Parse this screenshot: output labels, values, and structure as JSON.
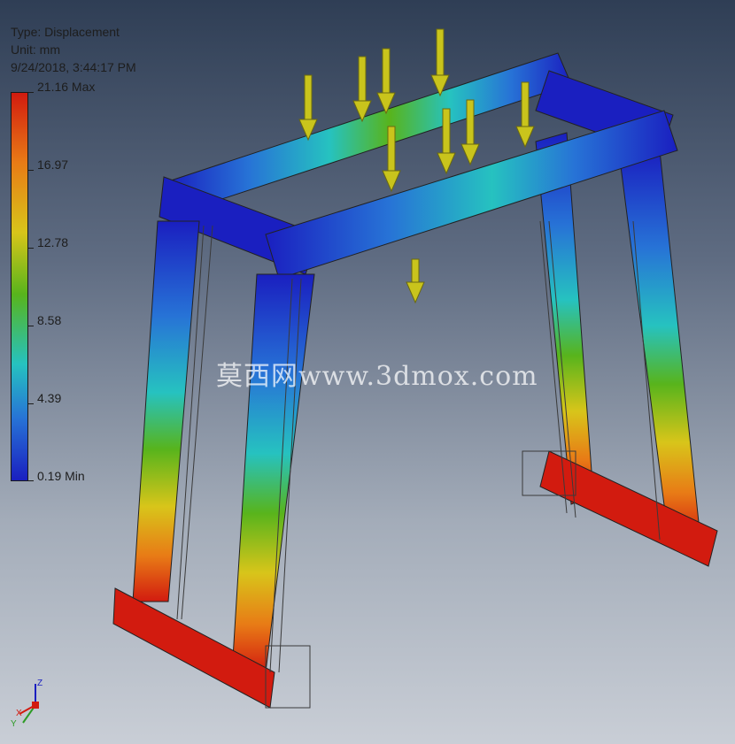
{
  "legend": {
    "type": "Type: Displacement",
    "unit": "Unit: mm",
    "timestamp": "9/24/2018, 3:44:17 PM",
    "ticks": [
      "21.16 Max",
      "16.97",
      "12.78",
      "8.58",
      "4.39",
      "0.19 Min"
    ]
  },
  "watermark": "莫西网www.3dmox.com",
  "triad": {
    "x": "X",
    "y": "Y",
    "z": "Z"
  },
  "colors": {
    "max": "#d21b0f",
    "high": "#e87b16",
    "midhigh": "#d8c51a",
    "mid": "#58b41c",
    "midlow": "#26c2c0",
    "low": "#2773d6",
    "min": "#1a1fc0",
    "load_arrow": "#c9c41c"
  }
}
